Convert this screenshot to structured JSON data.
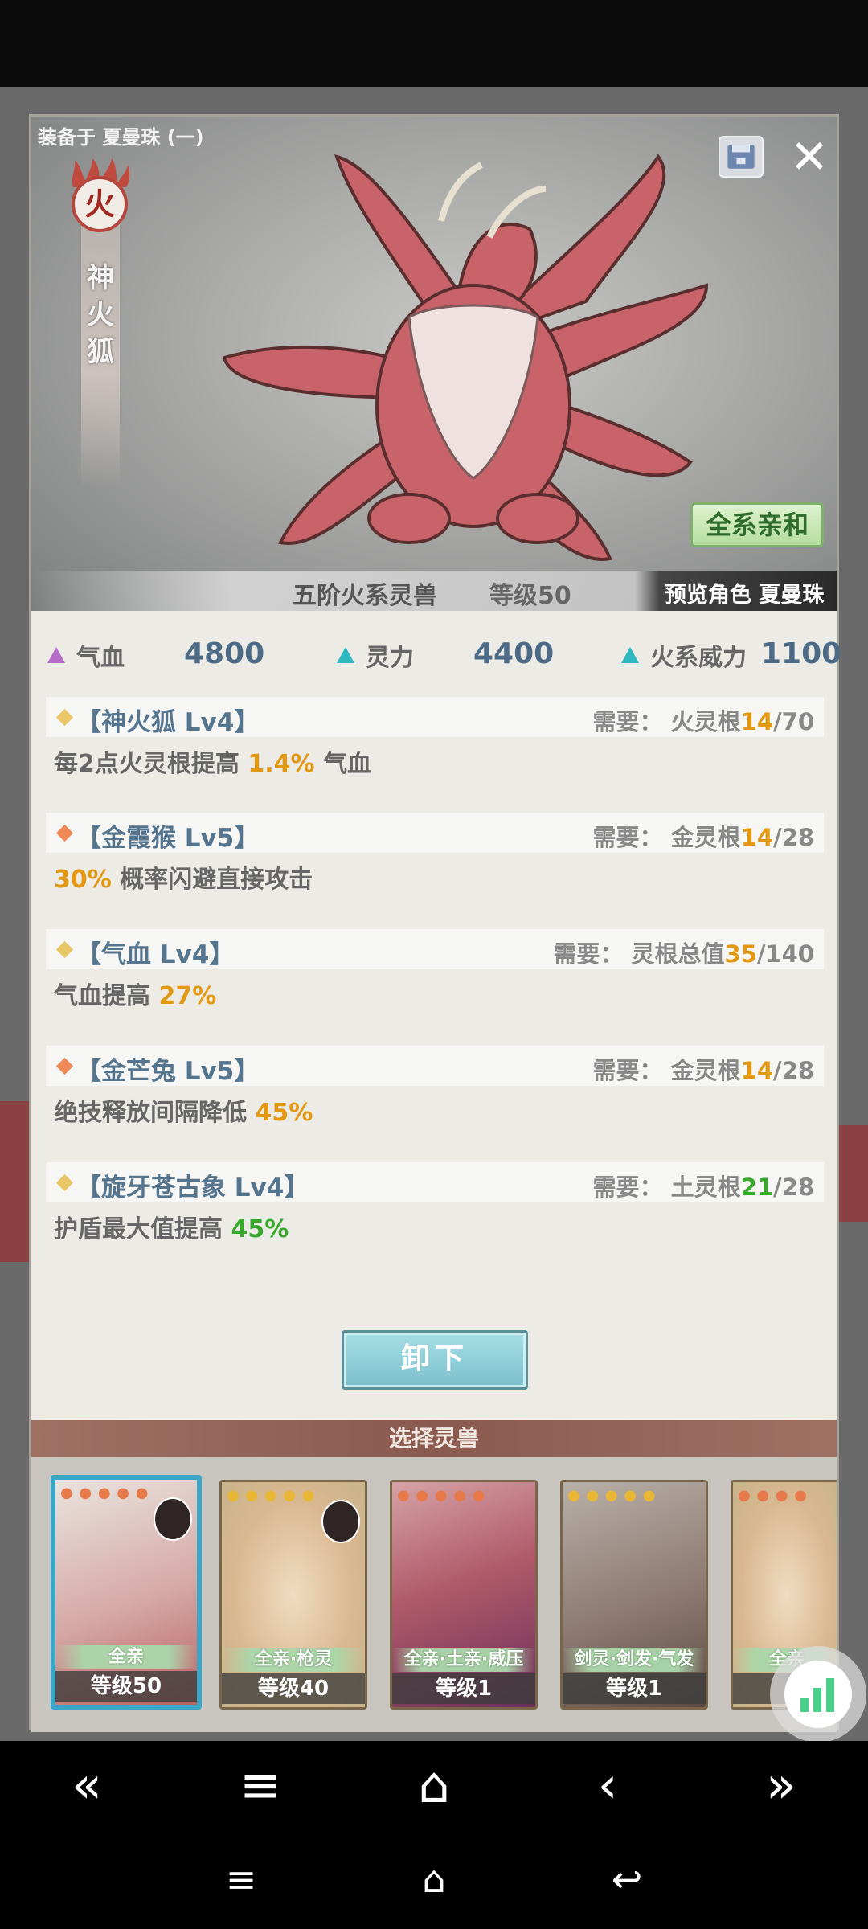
{
  "window": {
    "equipped_on": "装备于 夏曼珠 (一)"
  },
  "beast": {
    "element_char": "火",
    "name": "神火狐",
    "affinity": "全系亲和",
    "rank": "五阶火系灵兽",
    "level": "等级50",
    "preview_role": "预览角色 夏曼珠"
  },
  "stats": [
    {
      "label": "气血",
      "value": "4800",
      "icon": "purple-triangle"
    },
    {
      "label": "灵力",
      "value": "4400",
      "icon": "cyan-triangle"
    },
    {
      "label": "火系威力",
      "value": "1100",
      "icon": "cyan-triangle"
    }
  ],
  "skills": [
    {
      "name": "【神火狐 Lv4】",
      "req_label": "需要：",
      "req_type": "火灵根",
      "req_cur": "14",
      "req_max": "/70",
      "desc_pre": "每2点火灵根提高 ",
      "desc_hl": "1.4%",
      "desc_post": " 气血",
      "diamond": "yellow"
    },
    {
      "name": "【金霞猴 Lv5】",
      "req_label": "需要：",
      "req_type": "金灵根",
      "req_cur": "14",
      "req_max": "/28",
      "desc_pre": "",
      "desc_hl": "30%",
      "desc_post": " 概率闪避直接攻击",
      "diamond": "orange"
    },
    {
      "name": "【气血 Lv4】",
      "req_label": "需要：",
      "req_type": "灵根总值",
      "req_cur": "35",
      "req_max": "/140",
      "desc_pre": "气血提高 ",
      "desc_hl": "27%",
      "desc_post": "",
      "diamond": "yellow"
    },
    {
      "name": "【金芒兔 Lv5】",
      "req_label": "需要：",
      "req_type": "金灵根",
      "req_cur": "14",
      "req_max": "/28",
      "desc_pre": "绝技释放间隔降低 ",
      "desc_hl": "45%",
      "desc_post": "",
      "diamond": "orange"
    },
    {
      "name": "【旋牙苍古象 Lv4】",
      "req_label": "需要：",
      "req_type": "土灵根",
      "req_cur": "21",
      "req_max": "/28",
      "desc_pre": "护盾最大值提高 ",
      "desc_hl": "45%",
      "desc_post": "",
      "diamond": "yellow"
    }
  ],
  "actions": {
    "unequip": "卸下",
    "select_header": "选择灵兽"
  },
  "cards": [
    {
      "tag": "全亲",
      "level": "等级50"
    },
    {
      "tag": "全亲·枪灵",
      "level": "等级40"
    },
    {
      "tag": "全亲·土亲·威压",
      "level": "等级1"
    },
    {
      "tag": "剑灵·剑发·气发",
      "level": "等级1"
    },
    {
      "tag": "全亲",
      "level": ""
    }
  ],
  "colors": {
    "accent_orange": "#e39812",
    "accent_green": "#38a82c",
    "selected_border": "#3aa7c9"
  }
}
